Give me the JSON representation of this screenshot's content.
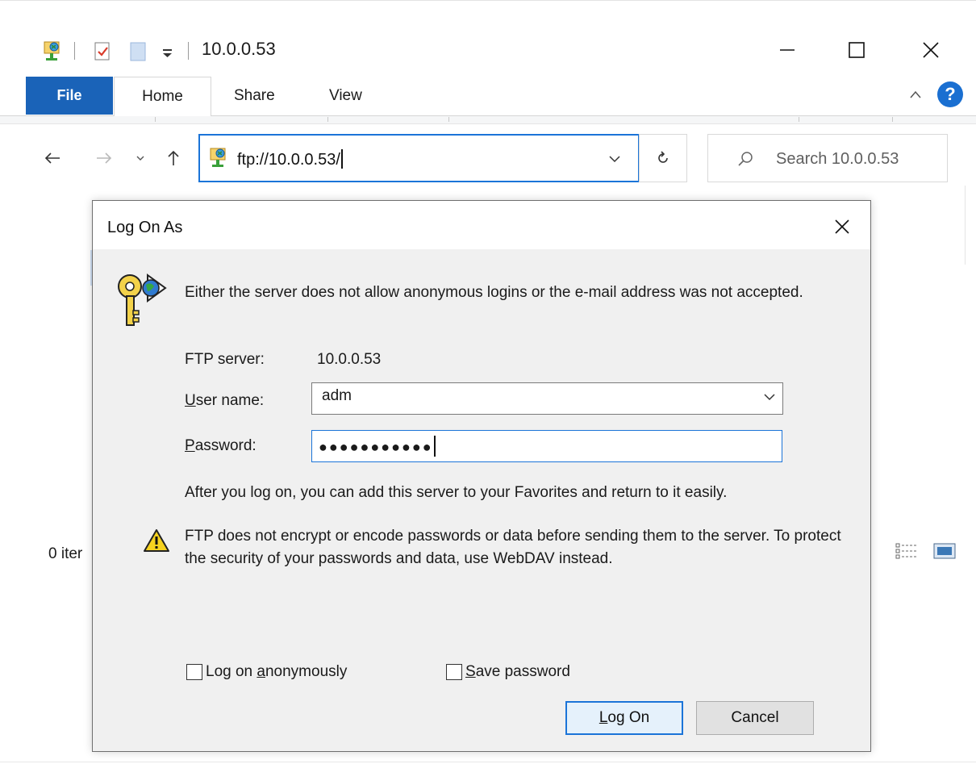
{
  "window": {
    "title": "10.0.0.53",
    "qat": {
      "icons": [
        "ftp-folder-icon",
        "properties-icon",
        "new-folder-icon",
        "customize-qat-icon"
      ]
    },
    "controls": {
      "minimize": "minimize-icon",
      "maximize": "maximize-icon",
      "close": "close-icon"
    }
  },
  "ribbon": {
    "tabs": [
      {
        "label": "File",
        "active": false
      },
      {
        "label": "Home",
        "active": true
      },
      {
        "label": "Share",
        "active": false
      },
      {
        "label": "View",
        "active": false
      }
    ],
    "help_label": "?"
  },
  "nav": {
    "address": "ftp://10.0.0.53/",
    "search_placeholder": "Search 10.0.0.53"
  },
  "status": {
    "items_text": "0 iter"
  },
  "dialog": {
    "title": "Log On As",
    "message": "Either the server does not allow anonymous logins or the e-mail address was not accepted.",
    "server_label": "FTP server:",
    "server_value": "10.0.0.53",
    "user_label_prefix": "U",
    "user_label_rest": "ser name:",
    "user_value": "adm",
    "password_label_prefix": "P",
    "password_label_rest": "assword:",
    "password_value": "●●●●●●●●●●●",
    "info": "After you log on, you can add this server to your Favorites and return to it easily.",
    "warning": "FTP does not encrypt or encode passwords or data before sending them to the server.  To protect the security of your passwords and data, use WebDAV instead.",
    "anon_label_pre": "Log on ",
    "anon_label_ul": "a",
    "anon_label_post": "nonymously",
    "anon_checked": false,
    "save_label_ul": "S",
    "save_label_post": "ave password",
    "save_checked": false,
    "logon_ul": "L",
    "logon_post": "og On",
    "cancel": "Cancel"
  },
  "colors": {
    "accent": "#1b74d8",
    "file_tab": "#1a63b8",
    "dialog_bg": "#f0f0f0"
  }
}
